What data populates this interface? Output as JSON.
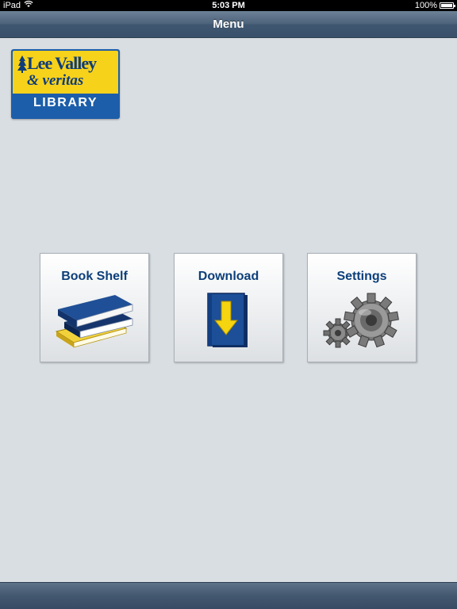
{
  "status_bar": {
    "carrier": "iPad",
    "time": "5:03 PM",
    "battery": "100%"
  },
  "nav_bar": {
    "title": "Menu"
  },
  "logo": {
    "brand": "Lee Valley",
    "subbrand": "& veritas",
    "library": "LIBRARY"
  },
  "menu": {
    "items": [
      {
        "label": "Book Shelf",
        "icon": "books-icon"
      },
      {
        "label": "Download",
        "icon": "download-book-icon"
      },
      {
        "label": "Settings",
        "icon": "gears-icon"
      }
    ]
  },
  "colors": {
    "background": "#d9dee3",
    "nav_bar": "#4c627a",
    "tile_label": "#0d3f7a",
    "logo_yellow": "#f7d21b",
    "logo_blue": "#1d5eaa"
  }
}
